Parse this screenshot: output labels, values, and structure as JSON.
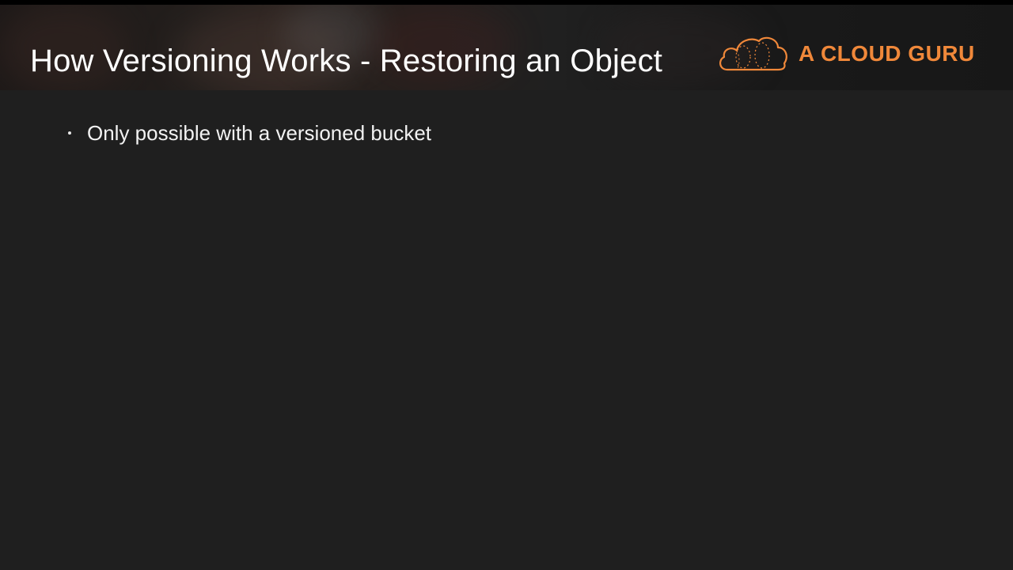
{
  "slide": {
    "title": "How Versioning Works - Restoring an Object",
    "logo": {
      "text": "A CLOUD GURU",
      "icon": "cloud-logo-icon",
      "color": "#f0883a"
    },
    "bullets": [
      {
        "text": "Only possible with a versioned bucket"
      }
    ]
  },
  "colors": {
    "background": "#1f1f1f",
    "title": "#ffffff",
    "accent": "#f0883a"
  }
}
